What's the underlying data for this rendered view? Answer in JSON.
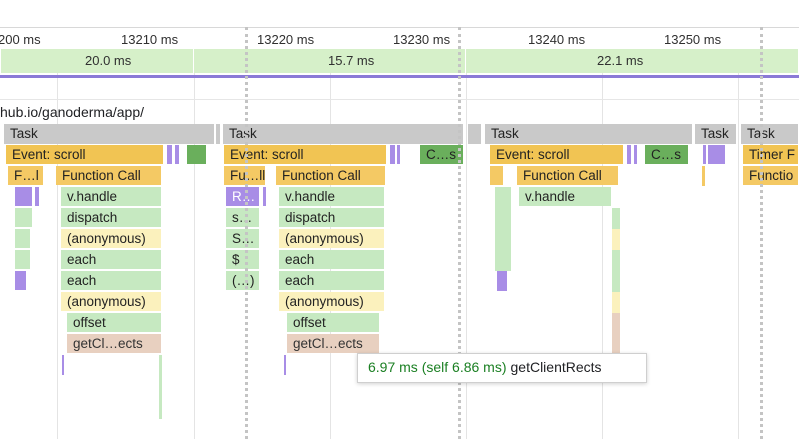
{
  "ruler": {
    "ticks": [
      "200 ms",
      "13210 ms",
      "13220 ms",
      "13230 ms",
      "13240 ms",
      "13250 ms"
    ]
  },
  "frames": [
    "20.0 ms",
    "15.7 ms",
    "22.1 ms"
  ],
  "thread": {
    "url": "hub.io/ganoderma/app/"
  },
  "tasks": [
    "Task",
    "Task",
    "Task",
    "Task",
    "Task"
  ],
  "stack1": {
    "event": "Event: scroll",
    "short_fn": "F…l",
    "function_call": "Function Call",
    "rows": [
      "v.handle",
      "dispatch",
      "(anonymous)",
      "each",
      "each",
      "(anonymous)",
      "offset",
      "getCl…ects"
    ]
  },
  "stack2": {
    "event": "Event: scroll",
    "compile": "C…s",
    "short_fn": "Fu…ll",
    "function_call": "Function Call",
    "left_col": [
      "R…",
      "s…",
      "S…",
      "$",
      "(…)"
    ],
    "rows": [
      "v.handle",
      "dispatch",
      "(anonymous)",
      "each",
      "each",
      "(anonymous)",
      "offset",
      "getCl…ects"
    ]
  },
  "stack3": {
    "event": "Event: scroll",
    "compile": "C…s",
    "function_call": "Function Call",
    "rows": [
      "v.handle"
    ]
  },
  "stack4": {
    "event": "Timer F",
    "function_call": "Functio"
  },
  "tooltip": {
    "time": "6.97 ms (self 6.86 ms)",
    "name": "getClientRects"
  }
}
